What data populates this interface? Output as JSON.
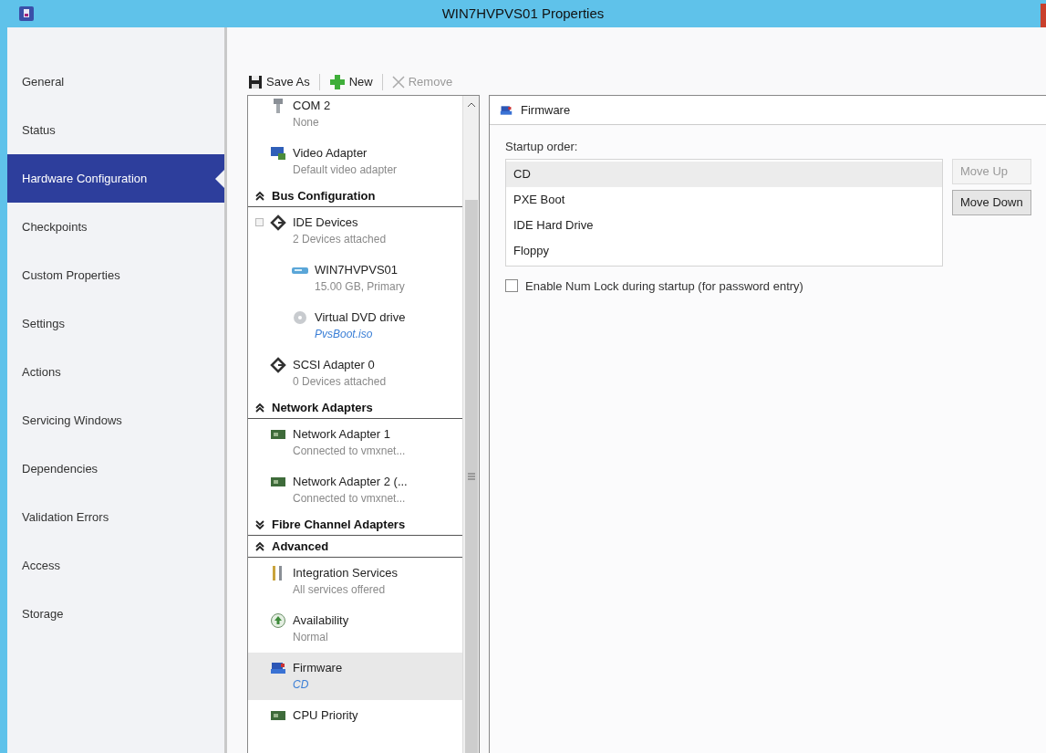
{
  "window": {
    "title": "WIN7HVPVS01 Properties"
  },
  "nav": [
    {
      "label": "General",
      "selected": false
    },
    {
      "label": "Status",
      "selected": false
    },
    {
      "label": "Hardware Configuration",
      "selected": true
    },
    {
      "label": "Checkpoints",
      "selected": false
    },
    {
      "label": "Custom Properties",
      "selected": false
    },
    {
      "label": "Settings",
      "selected": false
    },
    {
      "label": "Actions",
      "selected": false
    },
    {
      "label": "Servicing Windows",
      "selected": false
    },
    {
      "label": "Dependencies",
      "selected": false
    },
    {
      "label": "Validation Errors",
      "selected": false
    },
    {
      "label": "Access",
      "selected": false
    },
    {
      "label": "Storage",
      "selected": false
    }
  ],
  "toolbar": [
    {
      "label": "Save As",
      "disabled": false
    },
    {
      "label": "New",
      "disabled": false
    },
    {
      "label": "Remove",
      "disabled": true
    }
  ],
  "tree": [
    {
      "kind": "device",
      "name": "COM 2",
      "detail": "None",
      "selected": false
    },
    {
      "kind": "device",
      "name": "Video Adapter",
      "detail": "Default video adapter",
      "selected": false
    },
    {
      "kind": "section",
      "name": "Bus Configuration",
      "expanded": true
    },
    {
      "kind": "device",
      "name": "IDE Devices",
      "detail": "2 Devices attached",
      "selected": false,
      "expanded": true,
      "children": [
        {
          "kind": "device",
          "name": "WIN7HVPVS01",
          "detail": "15.00 GB, Primary",
          "selected": false
        },
        {
          "kind": "device",
          "name": "Virtual DVD drive",
          "detail": "PvsBoot.iso",
          "detail_link": true,
          "selected": false
        }
      ]
    },
    {
      "kind": "device",
      "name": "SCSI Adapter 0",
      "detail": "0 Devices attached",
      "selected": false
    },
    {
      "kind": "section",
      "name": "Network Adapters",
      "expanded": true
    },
    {
      "kind": "device",
      "name": "Network Adapter 1",
      "detail": "Connected to vmxnet...",
      "selected": false
    },
    {
      "kind": "device",
      "name": "Network Adapter 2 (...",
      "detail": "Connected to vmxnet...",
      "selected": false
    },
    {
      "kind": "section",
      "name": "Fibre Channel Adapters",
      "expanded": false
    },
    {
      "kind": "section",
      "name": "Advanced",
      "expanded": true
    },
    {
      "kind": "device",
      "name": "Integration Services",
      "detail": "All services offered",
      "selected": false
    },
    {
      "kind": "device",
      "name": "Availability",
      "detail": "Normal",
      "selected": false
    },
    {
      "kind": "device",
      "name": "Firmware",
      "detail": "CD",
      "detail_link": true,
      "selected": true
    },
    {
      "kind": "device",
      "name": "CPU Priority",
      "selected": false
    }
  ],
  "panel": {
    "title": "Firmware",
    "startup_label": "Startup order:",
    "boot_order": [
      {
        "label": "CD",
        "selected": true
      },
      {
        "label": "PXE Boot",
        "selected": false
      },
      {
        "label": "IDE Hard Drive",
        "selected": false
      },
      {
        "label": "Floppy",
        "selected": false
      }
    ],
    "buttons": [
      {
        "label": "Move Up",
        "disabled": true
      },
      {
        "label": "Move Down",
        "disabled": false
      }
    ],
    "numlock": {
      "label": "Enable Num Lock during startup (for password entry)",
      "checked": false
    }
  }
}
